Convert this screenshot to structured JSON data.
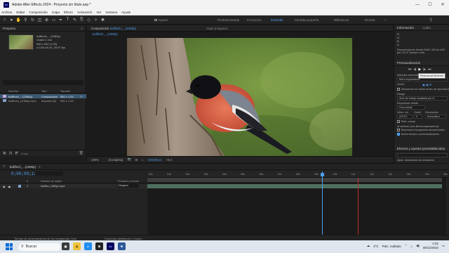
{
  "window": {
    "title": "Adobe After Effects 2024 - Proyecto sin título.aep *",
    "app_badge": "Ae",
    "controls": [
      "—",
      "☐",
      "✕"
    ]
  },
  "menu": [
    "Archivo",
    "Editar",
    "Composición",
    "Capa",
    "Efecto",
    "Animación",
    "Ver",
    "Ventana",
    "Ayuda"
  ],
  "toolbar": {
    "snap_label": "Ajustar",
    "workspaces": [
      "Predeterminado",
      "Formación",
      "Estándar",
      "Pantalla pequeña",
      "Bibliotecas",
      "Revisar"
    ],
    "active_workspace": "Estándar"
  },
  "project": {
    "header": "Proyecto",
    "item_name": "bullfinch_...(1080p)",
    "item_meta": [
      "Usado 1 vez",
      "960 x 540 (1,00)",
      "Δ 0;00;16;15, 29,97 fps"
    ],
    "columns": [
      "Nombre",
      "Tipo",
      "Tamaño"
    ],
    "rows": [
      {
        "name": "bullfinch_...(1080p)",
        "type": "Composición",
        "size": "960 x 1,00",
        "color": "#c6a7d9",
        "selected": true
      },
      {
        "name": "bullfinch_(1080p).mp4",
        "type": "Importar (8)",
        "size": "960 x 1,00",
        "color": "#7fa3c9",
        "selected": false
      }
    ],
    "bpc": "8 bpc"
  },
  "composition": {
    "tab_label": "Composición",
    "tab_name": "bullfinch_...(1080p)",
    "tab2": "Capa (ninguno)",
    "breadcrumb": "bullfinch_...(1080p)",
    "zoom": "100%",
    "quality": "(Completa)",
    "timecode": "0;00;09;12",
    "exposure": "+0,0"
  },
  "info_panel": {
    "tabs": [
      "Información",
      "Audio"
    ],
    "readout": [
      "R:",
      "G:",
      "B:",
      "A:"
    ],
    "note": "Reproduciendo desde RAM: 453 de 453 fps: 29,97 (tiempo real)"
  },
  "preview_panel": {
    "header": "Previsualización",
    "tooltip": "Reproducir/Detener",
    "labels": {
      "shortcut": "Métodos abreviados",
      "shortcut_value": "Barra espaciadora",
      "include": "Incluir:",
      "cache": "Almacenar en caché antes de reproducir",
      "range": "Rango",
      "range_value": "Área de trabajo ampliada por el...",
      "play_from": "Reproducir desde",
      "play_from_value": "Hora actual",
      "fps_label": "Veloc. fot.",
      "skip": "Omitir",
      "resolution": "Resolución",
      "fps_value": "(29,97)",
      "skip_value": "0",
      "resolution_value": "Automático",
      "fullscreen": "Pant. compl.",
      "on_stop": "Al detener (con Barra espaciadora):",
      "cached_frames": "Reproducir fotogramas almacenados",
      "move_time": "Mover tiempo a previsualización"
    }
  },
  "effects_panel": {
    "header": "Efectos y ajustes preestablecidos",
    "item": "Ajust. elaborados de animación"
  },
  "timeline": {
    "tab": "bullfinch_...(1080p)",
    "timecode": "0;00;09;12",
    "columns": [
      "#",
      "Nombre de origen",
      "Primario y vínculo"
    ],
    "layer": {
      "index": "1",
      "name": "bullfinc_1080p).mp4",
      "parent": "Ninguno"
    },
    "ruler": [
      "00s",
      "01s",
      "02s",
      "03s",
      "04s",
      "05s",
      "06s",
      "07s",
      "08s",
      "09s",
      "10s",
      "11s",
      "12s",
      "13s",
      "14s",
      "15s",
      "16s"
    ],
    "playhead_seconds": 9.4,
    "footer_left": "Tiempo de procesamiento de los fotogramas: 0ms",
    "footer_mid": "Conmutar definidores / modos"
  },
  "taskbar": {
    "search": "Buscar",
    "temperature": "4°C",
    "weather": "Parc. nublado",
    "time": "1:02",
    "date": "09/12/2023"
  }
}
